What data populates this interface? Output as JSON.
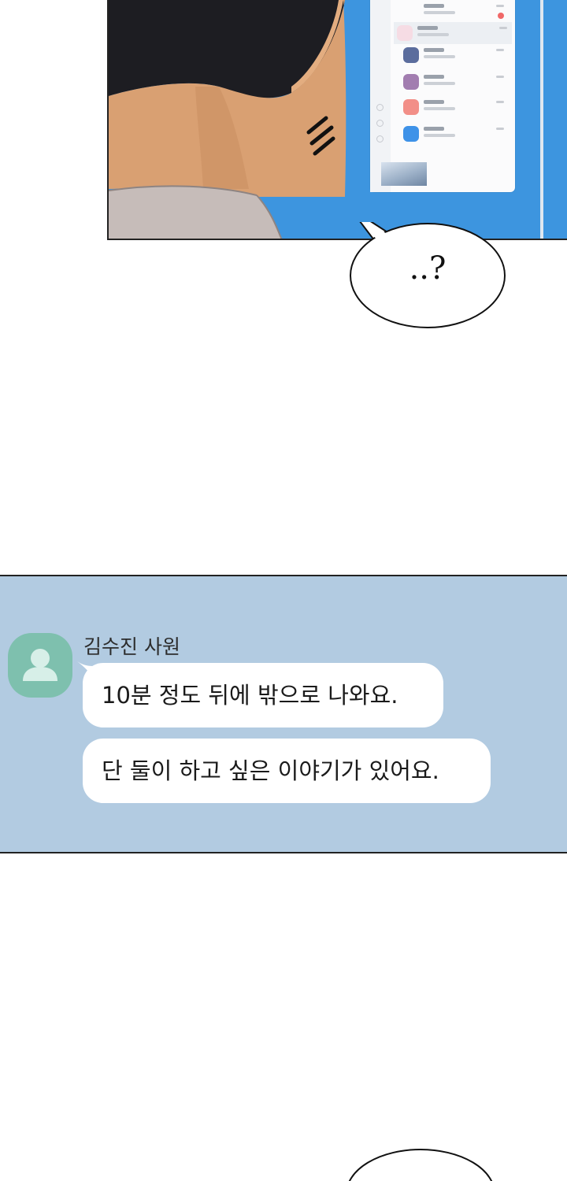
{
  "top_panel": {
    "speech_text": "..?",
    "chat_rows": [
      {
        "avatar_color": "#f6dce4",
        "selected": true,
        "badge": false
      },
      {
        "avatar_color": "#5b6d9d",
        "selected": false,
        "badge": false
      },
      {
        "avatar_color": "#a27db0",
        "selected": false,
        "badge": false
      },
      {
        "avatar_color": "#f28f88",
        "selected": false,
        "badge": false
      },
      {
        "avatar_color": "#3e92e8",
        "selected": false,
        "badge": false
      }
    ],
    "first_row_badge_color": "#f06868"
  },
  "message": {
    "sender_name": "김수진 사원",
    "avatar_icon": "person-icon",
    "avatar_color": "#7ec0ae",
    "panel_color": "#b2cbe1",
    "bubbles": [
      "10분 정도 뒤에 밖으로 나와요.",
      "단 둘이 하고 싶은 이야기가 있어요."
    ]
  }
}
